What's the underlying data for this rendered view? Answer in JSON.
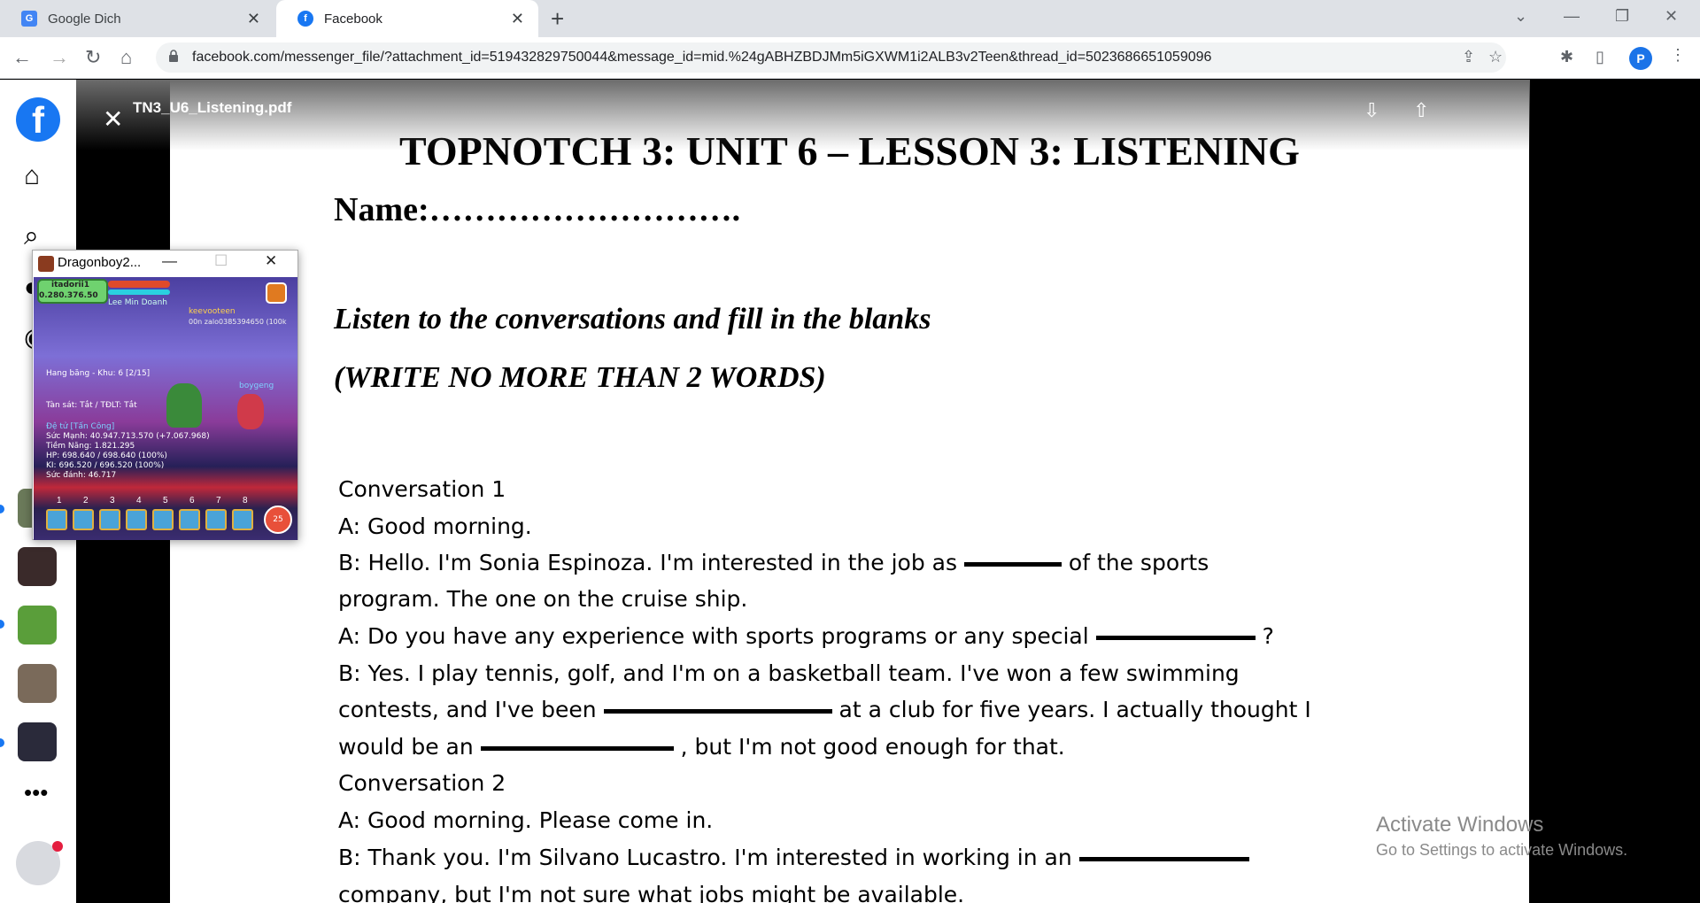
{
  "browser": {
    "tabs": [
      {
        "label": "Google Dich",
        "active": false
      },
      {
        "label": "Facebook",
        "active": true
      }
    ],
    "url": "facebook.com/messenger_file/?attachment_id=519432829750044&message_id=mid.%24gABHZBDJMm5iGXWM1i2ALB3v2Teen&thread_id=5023686651059096",
    "profile_initial": "P"
  },
  "viewer": {
    "file_name": "TN3_U6_Listening.pdf"
  },
  "document": {
    "title": "TOPNOTCH 3: UNIT 6 – LESSON 3: LISTENING",
    "name_line": "Name:……………………….",
    "instruction1": "Listen to the conversations and fill in the blanks",
    "instruction2": "(WRITE NO MORE THAN 2 WORDS)",
    "conv1_title": "Conversation 1",
    "c1_l1": "A:  Good morning.",
    "c1_l2a": "B:  Hello. I'm Sonia Espinoza. I'm interested in the job as",
    "c1_l2b": "of the sports",
    "c1_l3": "program. The one on the cruise ship.",
    "c1_l4a": "A:  Do you have any experience with sports programs or any special",
    "c1_l4b": "?",
    "c1_l5": "B:  Yes. I play tennis, golf, and I'm on a basketball team. I've won a few swimming",
    "c1_l6a": "contests, and I've been",
    "c1_l6b": "at a club for five years. I actually thought I",
    "c1_l7a": "would be an",
    "c1_l7b": ", but I'm not good enough for that.",
    "conv2_title": "Conversation 2",
    "c2_l1": "A:  Good morning. Please come in.",
    "c2_l2a": "B:  Thank you. I'm Silvano Lucastro. I'm interested in working in an",
    "c2_l3": "company, but I'm not sure what jobs might be available."
  },
  "watermark": {
    "line1": "Activate Windows",
    "line2": "Go to Settings to activate Windows."
  },
  "game_window": {
    "title": "Dragonboy2...",
    "player_name": "itadorii1",
    "player_gold": "0.280.376.50",
    "npc1": "Lee Min Doanh",
    "npc2": "keevooteen",
    "npc2_sub": "00n zalo0385394650 (100k",
    "zone": "Hang băng - Khu: 6 [2/15]",
    "mode": "Tàn sát: Tắt / TĐLT: Tắt",
    "enemy": "boygeng",
    "stats": [
      "Đệ tử [Tấn Công]",
      "Sức Mạnh: 40.947.713.570 (+7.067.968)",
      "Tiềm Năng: 1.821.295",
      "HP: 698.640 / 698.640 (100%)",
      "KI: 696.520 / 696.520 (100%)",
      "Sức đánh: 46.717"
    ],
    "skill_numbers": [
      "1",
      "2",
      "3",
      "4",
      "5",
      "6",
      "7",
      "8"
    ],
    "heart_count": "25"
  }
}
